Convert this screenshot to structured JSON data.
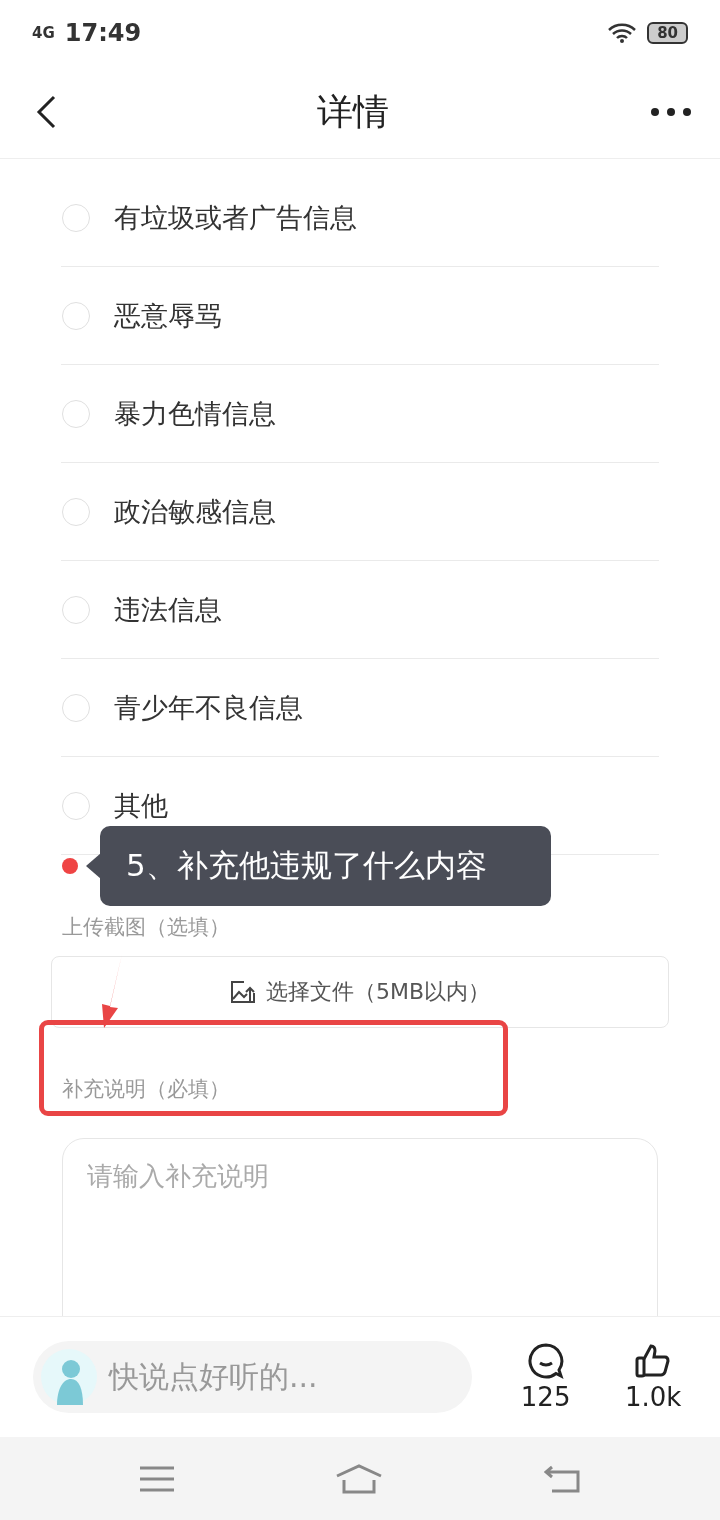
{
  "status_bar": {
    "network": "4G",
    "time": "17:49",
    "battery": "80"
  },
  "header": {
    "title": "详情"
  },
  "options": [
    {
      "label": "有垃圾或者广告信息",
      "selected": false
    },
    {
      "label": "恶意辱骂",
      "selected": false
    },
    {
      "label": "暴力色情信息",
      "selected": false
    },
    {
      "label": "政治敏感信息",
      "selected": false
    },
    {
      "label": "违法信息",
      "selected": false
    },
    {
      "label": "青少年不良信息",
      "selected": false
    },
    {
      "label": "其他",
      "selected": false
    }
  ],
  "tooltip": {
    "text": "5、补充他违规了什么内容"
  },
  "upload": {
    "label": "上传截图（选填）",
    "button": "选择文件（5MB以内）"
  },
  "note": {
    "label": "补充说明（必填）",
    "placeholder": "请输入补充说明"
  },
  "comment_bar": {
    "placeholder": "快说点好听的...",
    "comments": "125",
    "likes": "1.0k"
  }
}
